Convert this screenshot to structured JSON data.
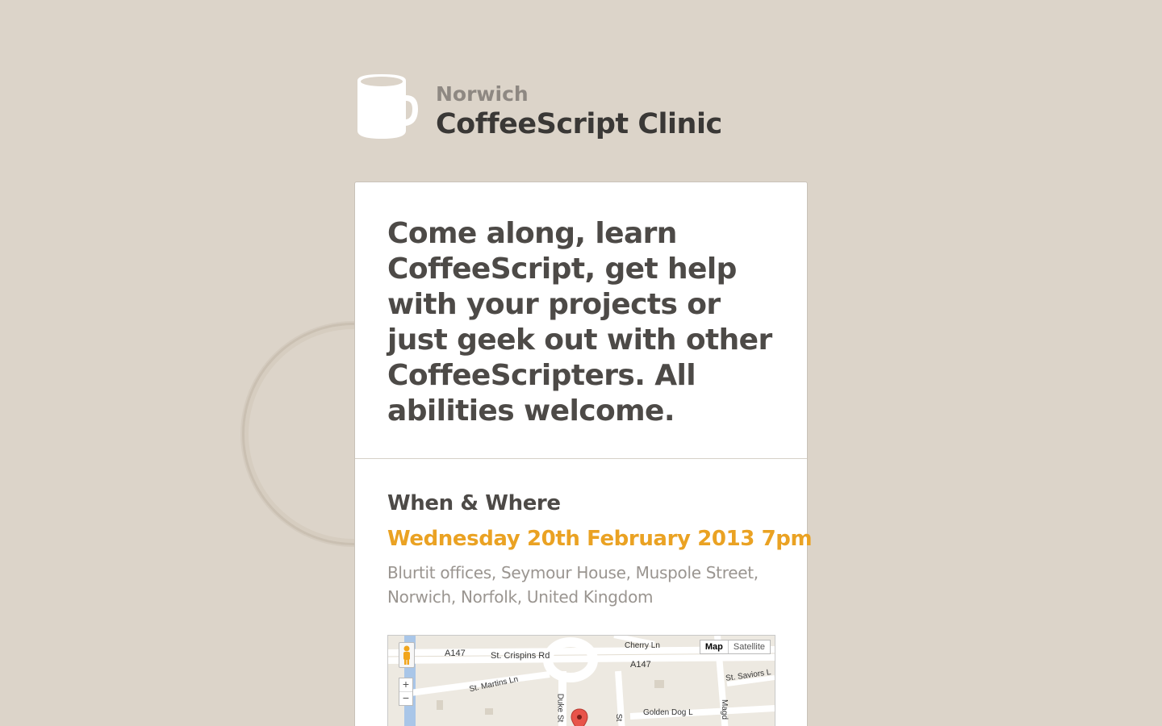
{
  "header": {
    "city": "Norwich",
    "title": "CoffeeScript Clinic",
    "logo_icon": "coffee-mug-icon"
  },
  "intro": {
    "text": "Come along, learn CoffeeScript, get help with your projects or just geek out with other CoffeeScripters. All abilities welcome."
  },
  "when_where": {
    "heading": "When & Where",
    "date": "Wednesday 20th February 2013 7pm",
    "address": "Blurtit offices, Seymour House, Muspole Street, Norwich, Norfolk, United Kingdom"
  },
  "map": {
    "type_buttons": {
      "map": "Map",
      "satellite": "Satellite"
    },
    "zoom_in": "+",
    "zoom_out": "−",
    "labels": {
      "a147_left": "A147",
      "st_crispins": "St. Crispins Rd",
      "cherry_ln": "Cherry Ln",
      "a147_right": "A147",
      "st_martins": "St. Martins Ln",
      "st_saviors": "St. Saviors L",
      "duke_st": "Duke St",
      "golden_dog": "Golden Dog L",
      "magd": "Magd",
      "st": "St"
    }
  },
  "colors": {
    "background": "#dcd4c9",
    "accent": "#eaa223",
    "text": "#4d4a47"
  }
}
